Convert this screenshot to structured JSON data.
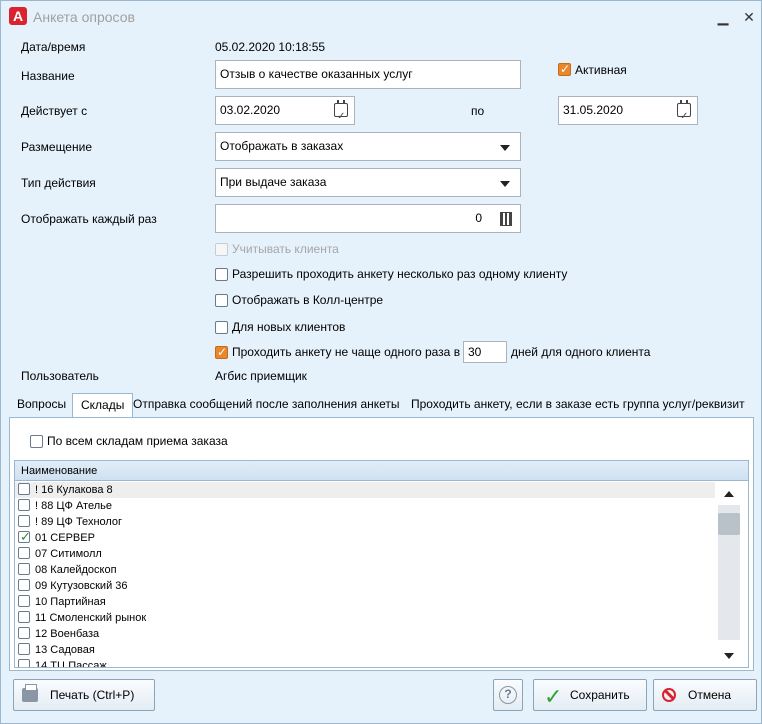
{
  "window": {
    "title": "Анкета опросов",
    "app_icon": "А"
  },
  "form": {
    "date_label": "Дата/время",
    "date_value": "05.02.2020 10:18:55",
    "name_label": "Название",
    "name_value": "Отзыв о качестве оказанных услуг",
    "active_label": "Активная",
    "active_checked": true,
    "valid_from_label": "Действует с",
    "valid_from_value": "03.02.2020",
    "valid_to_label": "по",
    "valid_to_value": "31.05.2020",
    "placement_label": "Размещение",
    "placement_value": "Отображать в заказах",
    "action_type_label": "Тип действия",
    "action_type_value": "При выдаче заказа",
    "display_each_label": "Отображать каждый раз",
    "display_each_value": "0",
    "options": {
      "consider_client": "Учитывать клиента",
      "allow_multiple": "Разрешить проходить анкету несколько раз одному клиенту",
      "show_callcenter": "Отображать в Колл-центре",
      "new_clients": "Для новых клиентов",
      "not_often_prefix": "Проходить анкету не чаще одного раза в",
      "not_often_days": "30",
      "not_often_suffix": "дней для одного клиента"
    },
    "user_label": "Пользователь",
    "user_value": "Агбис приемщик"
  },
  "tabs": [
    {
      "label": "Вопросы"
    },
    {
      "label": "Склады"
    },
    {
      "label": "Отправка сообщений после заполнения анкеты"
    },
    {
      "label": "Проходить анкету, если в заказе есть группа услуг/реквизит"
    }
  ],
  "warehouses": {
    "all_label": "По всем складам приема заказа",
    "column_header": "Наименование",
    "rows": [
      {
        "name": "! 16 Кулакова 8",
        "checked": false
      },
      {
        "name": "! 88 ЦФ Ателье",
        "checked": false
      },
      {
        "name": "! 89 ЦФ Технолог",
        "checked": false
      },
      {
        "name": "01 СЕРВЕР",
        "checked": true
      },
      {
        "name": "07 Ситимолл",
        "checked": false
      },
      {
        "name": "08 Калейдоскоп",
        "checked": false
      },
      {
        "name": "09 Кутузовский 36",
        "checked": false
      },
      {
        "name": "10 Партийная",
        "checked": false
      },
      {
        "name": "11 Смоленский рынок",
        "checked": false
      },
      {
        "name": "12 Военбаза",
        "checked": false
      },
      {
        "name": "13 Садовая",
        "checked": false
      },
      {
        "name": "14 ТЦ Пассаж",
        "checked": false
      }
    ]
  },
  "buttons": {
    "print": "Печать (Ctrl+P)",
    "help": "?",
    "save": "Сохранить",
    "cancel": "Отмена"
  }
}
